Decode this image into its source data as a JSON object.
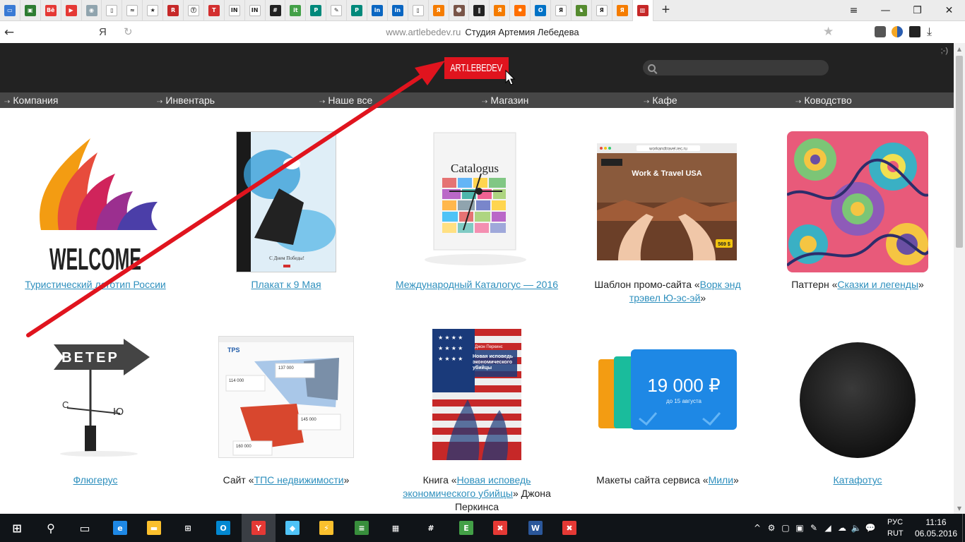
{
  "browser": {
    "tabs": [
      {
        "icon": "chat-icon",
        "color": "#3a7bd5",
        "glyph": "▭"
      },
      {
        "icon": "app-icon",
        "color": "#2e7d32",
        "glyph": "▣"
      },
      {
        "icon": "behance-icon",
        "color": "#e53935",
        "glyph": "Bē"
      },
      {
        "icon": "youtube-icon",
        "color": "#e53935",
        "glyph": "▶"
      },
      {
        "icon": "circle-icon",
        "color": "#90a4ae",
        "glyph": "◉"
      },
      {
        "icon": "document-icon",
        "color": "#ffffff",
        "glyph": "▯"
      },
      {
        "icon": "wave-icon",
        "color": "#ffffff",
        "glyph": "≈"
      },
      {
        "icon": "star-icon",
        "color": "#ffffff",
        "glyph": "★"
      },
      {
        "icon": "r-icon",
        "color": "#c62828",
        "glyph": "R"
      },
      {
        "icon": "t-icon",
        "color": "#ffffff",
        "glyph": "Ⓣ"
      },
      {
        "icon": "tech-icon",
        "color": "#d32f2f",
        "glyph": "T"
      },
      {
        "icon": "in-icon",
        "color": "#ffffff",
        "glyph": "IN"
      },
      {
        "icon": "in-icon",
        "color": "#ffffff",
        "glyph": "IN"
      },
      {
        "icon": "hash-icon",
        "color": "#212121",
        "glyph": "#"
      },
      {
        "icon": "it-icon",
        "color": "#43a047",
        "glyph": "it"
      },
      {
        "icon": "p-icon",
        "color": "#00897b",
        "glyph": "P"
      },
      {
        "icon": "pen-icon",
        "color": "#ffffff",
        "glyph": "✎"
      },
      {
        "icon": "p-icon",
        "color": "#00897b",
        "glyph": "P"
      },
      {
        "icon": "linkedin-icon",
        "color": "#0a66c2",
        "glyph": "in"
      },
      {
        "icon": "linkedin-icon",
        "color": "#0a66c2",
        "glyph": "in"
      },
      {
        "icon": "document-icon",
        "color": "#ffffff",
        "glyph": "▯"
      },
      {
        "icon": "yarko-icon",
        "color": "#f57c00",
        "glyph": "Я"
      },
      {
        "icon": "mask-icon",
        "color": "#795548",
        "glyph": "☻"
      },
      {
        "icon": "pause-icon",
        "color": "#212121",
        "glyph": "‖"
      },
      {
        "icon": "yarko-icon",
        "color": "#f57c00",
        "glyph": "Я"
      },
      {
        "icon": "sun-icon",
        "color": "#ff6f00",
        "glyph": "✸"
      },
      {
        "icon": "outlook-icon",
        "color": "#0072c6",
        "glyph": "O"
      },
      {
        "icon": "yandex-icon",
        "color": "#ffffff",
        "glyph": "Я"
      },
      {
        "icon": "dragon-icon",
        "color": "#558b2f",
        "glyph": "♞"
      },
      {
        "icon": "yandex-icon",
        "color": "#ffffff",
        "glyph": "Я"
      },
      {
        "icon": "yarko-icon",
        "color": "#f57c00",
        "glyph": "Я"
      },
      {
        "icon": "artlebedev-icon",
        "color": "#c62828",
        "glyph": "▥"
      }
    ],
    "active_tab_index": 31,
    "new_tab": "+",
    "window_controls": [
      "≡",
      "—",
      "❐",
      "✕"
    ],
    "back": "←",
    "search_logo": "Я",
    "reload": "↻",
    "url_domain": "www.artlebedev.ru",
    "page_title": "Студия Артемия Лебедева",
    "bookmark": "★",
    "download": "⤓"
  },
  "site": {
    "corner_text": ";-)",
    "logo_text": "ART.LEBEDEV",
    "search_placeholder": "",
    "nav": [
      {
        "label": "Компания"
      },
      {
        "label": "Инвентарь"
      },
      {
        "label": "Наше все"
      },
      {
        "label": "Магазин"
      },
      {
        "label": "Кафе"
      },
      {
        "label": "Ководство"
      }
    ],
    "items": [
      {
        "before": "",
        "link": "Туристический логотип России",
        "after": ""
      },
      {
        "before": "",
        "link": "Плакат к 9 Мая",
        "after": ""
      },
      {
        "before": "",
        "link": "Международный Каталогус — 2016",
        "after": ""
      },
      {
        "before": "Шаблон промо-сайта «",
        "link": "Ворк энд трэвел Ю-эс-эй",
        "after": "»"
      },
      {
        "before": "Паттерн «",
        "link": "Сказки и легенды",
        "after": "»"
      },
      {
        "before": "",
        "link": "Флюгерус",
        "after": ""
      },
      {
        "before": "Сайт «",
        "link": "ТПС недвижимости",
        "after": "»"
      },
      {
        "before": "Книга «",
        "link": "Новая исповедь экономического убийцы",
        "after": "» Джона Перкинса"
      },
      {
        "before": "Макеты сайта сервиса «",
        "link": "Мили",
        "after": "»"
      },
      {
        "before": "",
        "link": "Катафотус",
        "after": ""
      }
    ],
    "thumb_texts": {
      "welcome": "WELCOME",
      "poster": "С Днем Победы!",
      "catalogus": "Catalogus",
      "worktravel_url": "workandtravel.iec.ru",
      "worktravel_title": "Work & Travel USA",
      "worktravel_price": "569 $",
      "veter": "ВЕТЕР",
      "vane_s": "С",
      "vane_yu": "Ю",
      "tps_logo": "TPS",
      "tps_p1": "114 000",
      "tps_p2": "137 000",
      "tps_p3": "145 000",
      "tps_p4": "160 000",
      "book_author": "Джон Перкинс",
      "book_title": "Новая исповедь экономического убийцы",
      "miles_amount": "19 000 ₽",
      "miles_note": "до 15 августа"
    }
  },
  "taskbar": {
    "apps": [
      {
        "icon": "windows-start-icon",
        "color": "#ffffff",
        "glyph": "⊞"
      },
      {
        "icon": "search-icon",
        "color": "#ffffff",
        "glyph": "⚲"
      },
      {
        "icon": "task-view-icon",
        "color": "#ffffff",
        "glyph": "▭"
      },
      {
        "icon": "edge-icon",
        "color": "#1e88e5",
        "glyph": "e"
      },
      {
        "icon": "explorer-icon",
        "color": "#fbc02d",
        "glyph": "▬"
      },
      {
        "icon": "store-icon",
        "color": "#ffffff",
        "glyph": "⊞"
      },
      {
        "icon": "outlook-icon",
        "color": "#0288d1",
        "glyph": "O"
      },
      {
        "icon": "yandex-browser-icon",
        "color": "#e53935",
        "glyph": "Y"
      },
      {
        "icon": "app-icon",
        "color": "#4fc3f7",
        "glyph": "◆"
      },
      {
        "icon": "bolt-icon",
        "color": "#fbc02d",
        "glyph": "⚡"
      },
      {
        "icon": "farmanager-icon",
        "color": "#388e3c",
        "glyph": "≡"
      },
      {
        "icon": "calculator-icon",
        "color": "#ffffff",
        "glyph": "▦"
      },
      {
        "icon": "slack-icon",
        "color": "#ffffff",
        "glyph": "#"
      },
      {
        "icon": "evernote-icon",
        "color": "#43a047",
        "glyph": "E"
      },
      {
        "icon": "xmind-icon",
        "color": "#e53935",
        "glyph": "✖"
      },
      {
        "icon": "word-icon",
        "color": "#2b579a",
        "glyph": "W"
      },
      {
        "icon": "xmind-icon",
        "color": "#e53935",
        "glyph": "✖"
      }
    ],
    "active_index": 7,
    "tray_icons": [
      "^",
      "⚙",
      "▢",
      "▣",
      "✎",
      "◢",
      "☁",
      "🔈",
      "💬"
    ],
    "lang": "РУС",
    "lang_sub": "RUT",
    "time": "11:16",
    "date": "06.05.2016"
  },
  "colors": {
    "brand_red": "#e0141e",
    "link": "#2d8fbd",
    "header_bg": "#222222",
    "nav_bg": "#474747",
    "annotation_arrow": "#e0141e"
  }
}
